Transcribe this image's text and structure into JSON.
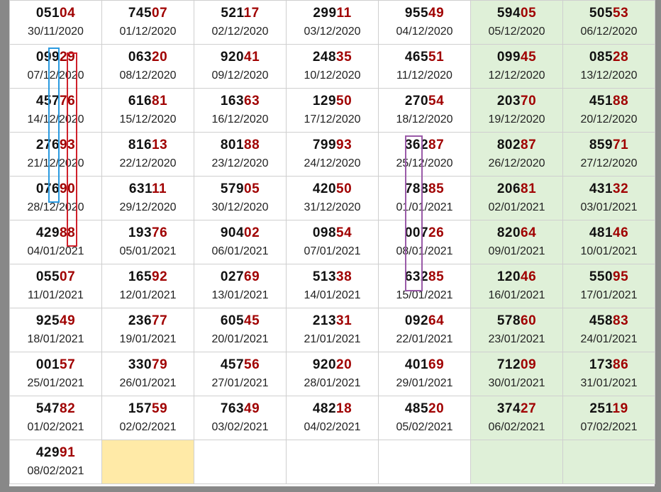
{
  "rows": [
    [
      {
        "lead": "051",
        "tail": "04",
        "date": "30/11/2020"
      },
      {
        "lead": "745",
        "tail": "07",
        "date": "01/12/2020"
      },
      {
        "lead": "521",
        "tail": "17",
        "date": "02/12/2020"
      },
      {
        "lead": "299",
        "tail": "11",
        "date": "03/12/2020"
      },
      {
        "lead": "955",
        "tail": "49",
        "date": "04/12/2020"
      },
      {
        "lead": "594",
        "tail": "05",
        "date": "05/12/2020"
      },
      {
        "lead": "505",
        "tail": "53",
        "date": "06/12/2020"
      }
    ],
    [
      {
        "lead": "099",
        "tail": "29",
        "date": "07/12/2020"
      },
      {
        "lead": "063",
        "tail": "20",
        "date": "08/12/2020"
      },
      {
        "lead": "920",
        "tail": "41",
        "date": "09/12/2020"
      },
      {
        "lead": "248",
        "tail": "35",
        "date": "10/12/2020"
      },
      {
        "lead": "465",
        "tail": "51",
        "date": "11/12/2020"
      },
      {
        "lead": "099",
        "tail": "45",
        "date": "12/12/2020"
      },
      {
        "lead": "085",
        "tail": "28",
        "date": "13/12/2020"
      }
    ],
    [
      {
        "lead": "457",
        "tail": "76",
        "date": "14/12/2020"
      },
      {
        "lead": "616",
        "tail": "81",
        "date": "15/12/2020"
      },
      {
        "lead": "163",
        "tail": "63",
        "date": "16/12/2020"
      },
      {
        "lead": "129",
        "tail": "50",
        "date": "17/12/2020"
      },
      {
        "lead": "270",
        "tail": "54",
        "date": "18/12/2020"
      },
      {
        "lead": "203",
        "tail": "70",
        "date": "19/12/2020"
      },
      {
        "lead": "451",
        "tail": "88",
        "date": "20/12/2020"
      }
    ],
    [
      {
        "lead": "276",
        "tail": "93",
        "date": "21/12/2020"
      },
      {
        "lead": "816",
        "tail": "13",
        "date": "22/12/2020"
      },
      {
        "lead": "801",
        "tail": "88",
        "date": "23/12/2020"
      },
      {
        "lead": "799",
        "tail": "93",
        "date": "24/12/2020"
      },
      {
        "lead": "362",
        "tail": "87",
        "date": "25/12/2020"
      },
      {
        "lead": "802",
        "tail": "87",
        "date": "26/12/2020"
      },
      {
        "lead": "859",
        "tail": "71",
        "date": "27/12/2020"
      }
    ],
    [
      {
        "lead": "076",
        "tail": "90",
        "date": "28/12/2020"
      },
      {
        "lead": "631",
        "tail": "11",
        "date": "29/12/2020"
      },
      {
        "lead": "579",
        "tail": "05",
        "date": "30/12/2020"
      },
      {
        "lead": "420",
        "tail": "50",
        "date": "31/12/2020"
      },
      {
        "lead": "788",
        "tail": "85",
        "date": "01/01/2021"
      },
      {
        "lead": "206",
        "tail": "81",
        "date": "02/01/2021"
      },
      {
        "lead": "431",
        "tail": "32",
        "date": "03/01/2021"
      }
    ],
    [
      {
        "lead": "429",
        "tail": "88",
        "date": "04/01/2021"
      },
      {
        "lead": "193",
        "tail": "76",
        "date": "05/01/2021"
      },
      {
        "lead": "904",
        "tail": "02",
        "date": "06/01/2021"
      },
      {
        "lead": "098",
        "tail": "54",
        "date": "07/01/2021"
      },
      {
        "lead": "007",
        "tail": "26",
        "date": "08/01/2021"
      },
      {
        "lead": "820",
        "tail": "64",
        "date": "09/01/2021"
      },
      {
        "lead": "481",
        "tail": "46",
        "date": "10/01/2021"
      }
    ],
    [
      {
        "lead": "055",
        "tail": "07",
        "date": "11/01/2021"
      },
      {
        "lead": "165",
        "tail": "92",
        "date": "12/01/2021"
      },
      {
        "lead": "027",
        "tail": "69",
        "date": "13/01/2021"
      },
      {
        "lead": "513",
        "tail": "38",
        "date": "14/01/2021"
      },
      {
        "lead": "632",
        "tail": "85",
        "date": "15/01/2021"
      },
      {
        "lead": "120",
        "tail": "46",
        "date": "16/01/2021"
      },
      {
        "lead": "550",
        "tail": "95",
        "date": "17/01/2021"
      }
    ],
    [
      {
        "lead": "925",
        "tail": "49",
        "date": "18/01/2021"
      },
      {
        "lead": "236",
        "tail": "77",
        "date": "19/01/2021"
      },
      {
        "lead": "605",
        "tail": "45",
        "date": "20/01/2021"
      },
      {
        "lead": "213",
        "tail": "31",
        "date": "21/01/2021"
      },
      {
        "lead": "092",
        "tail": "64",
        "date": "22/01/2021"
      },
      {
        "lead": "578",
        "tail": "60",
        "date": "23/01/2021"
      },
      {
        "lead": "458",
        "tail": "83",
        "date": "24/01/2021"
      }
    ],
    [
      {
        "lead": "001",
        "tail": "57",
        "date": "25/01/2021"
      },
      {
        "lead": "330",
        "tail": "79",
        "date": "26/01/2021"
      },
      {
        "lead": "457",
        "tail": "56",
        "date": "27/01/2021"
      },
      {
        "lead": "920",
        "tail": "20",
        "date": "28/01/2021"
      },
      {
        "lead": "401",
        "tail": "69",
        "date": "29/01/2021"
      },
      {
        "lead": "712",
        "tail": "09",
        "date": "30/01/2021"
      },
      {
        "lead": "173",
        "tail": "86",
        "date": "31/01/2021"
      }
    ],
    [
      {
        "lead": "547",
        "tail": "82",
        "date": "01/02/2021"
      },
      {
        "lead": "157",
        "tail": "59",
        "date": "02/02/2021"
      },
      {
        "lead": "763",
        "tail": "49",
        "date": "03/02/2021"
      },
      {
        "lead": "482",
        "tail": "18",
        "date": "04/02/2021"
      },
      {
        "lead": "485",
        "tail": "20",
        "date": "05/02/2021"
      },
      {
        "lead": "374",
        "tail": "27",
        "date": "06/02/2021"
      },
      {
        "lead": "251",
        "tail": "19",
        "date": "07/02/2021"
      }
    ],
    [
      {
        "lead": "429",
        "tail": "91",
        "date": "08/02/2021"
      },
      null,
      null,
      null,
      null,
      null,
      null
    ]
  ],
  "colors": {
    "lead_digits": "#111111",
    "tail_digits": "#a00000",
    "weekend_bg": "#dff0d8",
    "highlight_empty_bg": "#ffeaa7",
    "mark_blue": "#2a9ae0",
    "mark_red": "#d0202a",
    "mark_purple": "#9a5aa8"
  }
}
